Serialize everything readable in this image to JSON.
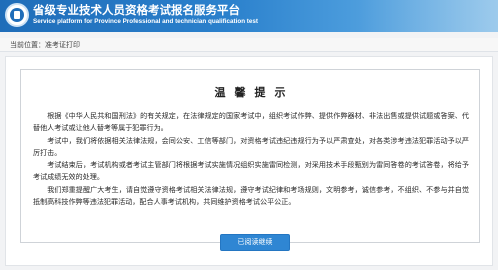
{
  "header": {
    "logo_icon": "seal-logo-icon",
    "title": "省级专业技术人员资格考试报名服务平台",
    "subtitle": "Service platform for Province Professional and technician qualification test"
  },
  "breadcrumb": {
    "prefix": "当前位置：",
    "current": "准考证打印"
  },
  "notice": {
    "title": "温馨提示",
    "paragraphs": [
      "根据《中华人民共和国刑法》的有关规定，在法律规定的国家考试中，组织考试作弊、提供作弊器材、非法出售或提供试题或答案、代替他人考试或让他人替考等属于犯罪行为。",
      "考试中，我们将依据相关法律法规，会同公安、工信等部门，对资格考试违纪违规行为予以严肃查处，对各类涉考违法犯罪活动予以严厉打击。",
      "考试结束后，考试机构或者考试主管部门将根据考试实施情况组织实施雷同检测，对采用技术手段甄别为雷同答卷的考试答卷，将给予考试成绩无效的处理。",
      "我们郑重提醒广大考生，请自觉遵守资格考试相关法律法规，遵守考试纪律和考场规则，文明参考，诚信参考，不组织、不参与并自觉抵制高科技作弊等违法犯罪活动，配合人事考试机构，共同维护资格考试公平公正。"
    ]
  },
  "actions": {
    "continue_label": "已阅读继续"
  },
  "colors": {
    "header_blue": "#1f6db9",
    "button_blue": "#2f86d3"
  }
}
